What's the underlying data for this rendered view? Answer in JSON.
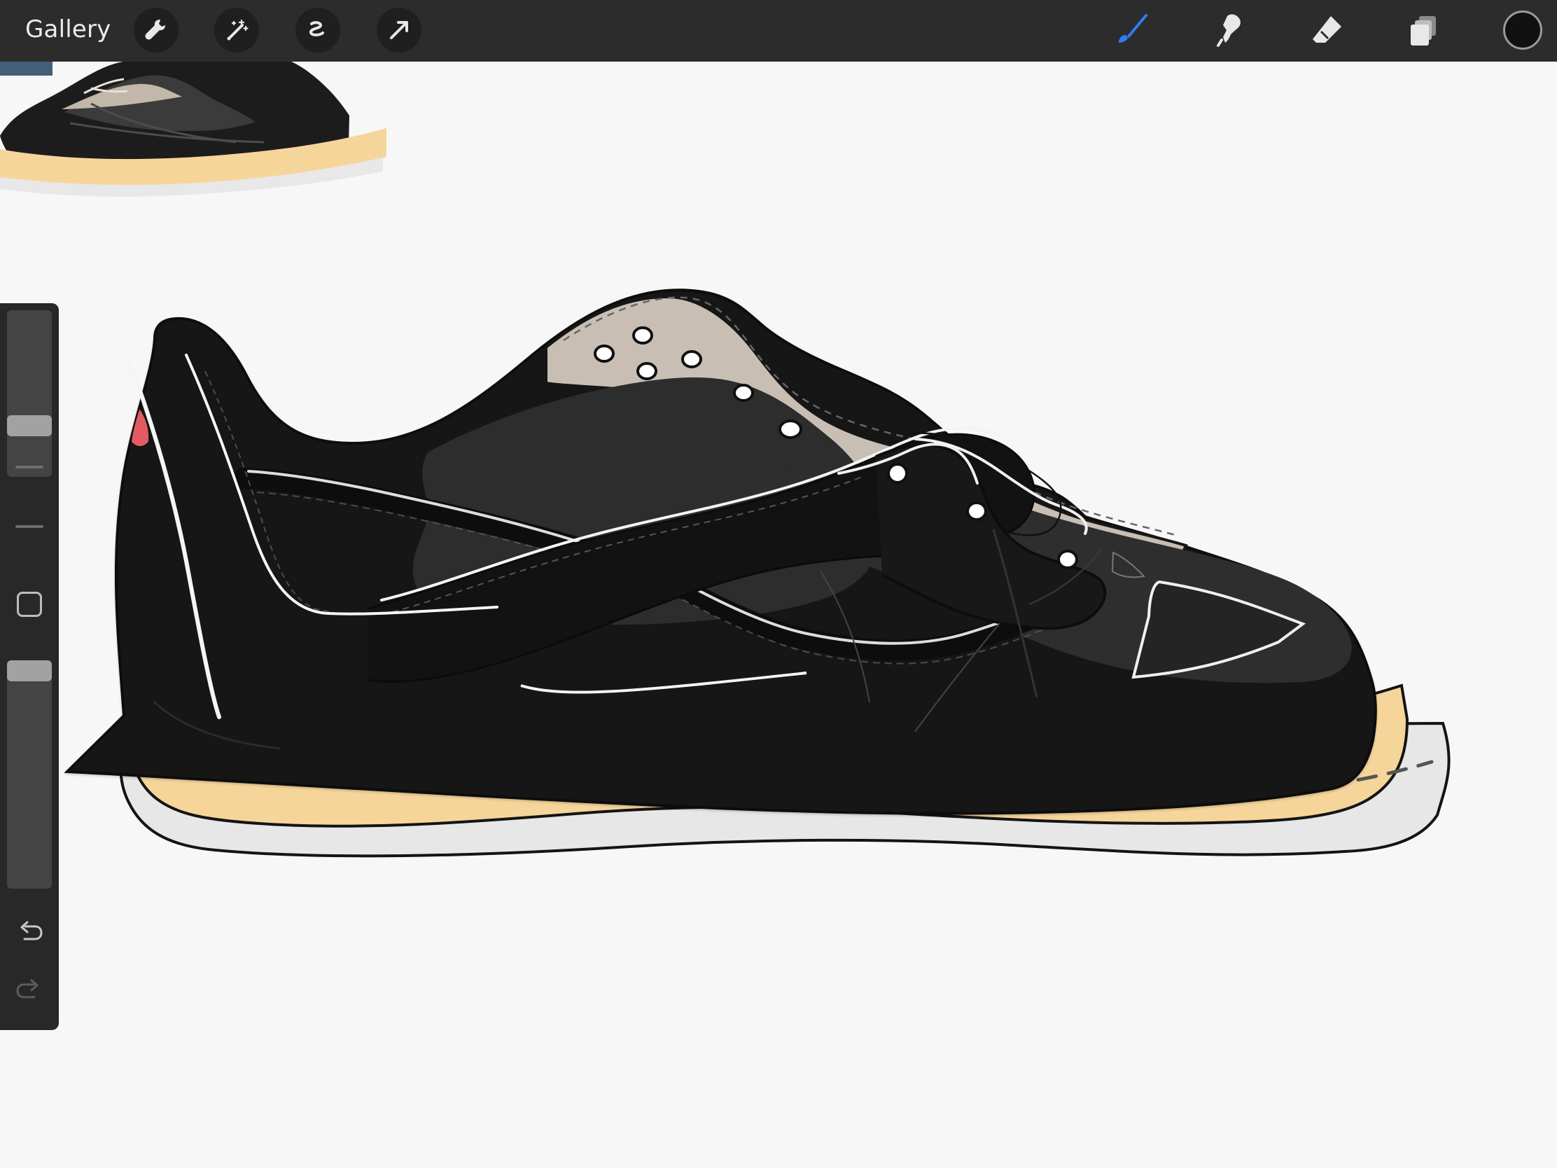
{
  "app": {
    "gallery_label": "Gallery"
  },
  "toolbar": {
    "left_tools": [
      {
        "name": "actions",
        "icon": "wrench-icon"
      },
      {
        "name": "adjustments",
        "icon": "magic-wand-icon"
      },
      {
        "name": "selection",
        "icon": "selection-icon"
      },
      {
        "name": "transform",
        "icon": "arrow-icon"
      }
    ],
    "right_tools": [
      {
        "name": "brush",
        "icon": "brush-icon",
        "active": true,
        "color": "#2f7cf6"
      },
      {
        "name": "smudge",
        "icon": "smudge-icon",
        "active": false
      },
      {
        "name": "eraser",
        "icon": "eraser-icon",
        "active": false
      },
      {
        "name": "layers",
        "icon": "layers-icon",
        "active": false
      }
    ],
    "current_color": "#111111"
  },
  "sidebar": {
    "brush_size_level": 0.48,
    "opacity_level": 0.04,
    "undo_icon": "undo-icon",
    "redo_icon": "redo-icon",
    "modify_icon": "square-icon"
  },
  "canvas": {
    "background": "#f7f7f7",
    "artwork": "sneaker-illustration"
  },
  "colors": {
    "toolbar": "#2c2c2c",
    "sidebar": "#282828",
    "active_blue": "#2f7cf6",
    "shoe_black": "#181818",
    "panel_dark": "#2d2d2d",
    "tongue_beige": "#c8beb4",
    "midsole": "#f6d59b",
    "outsole": "#e8e8e8",
    "heel_red": "#e25b62"
  }
}
